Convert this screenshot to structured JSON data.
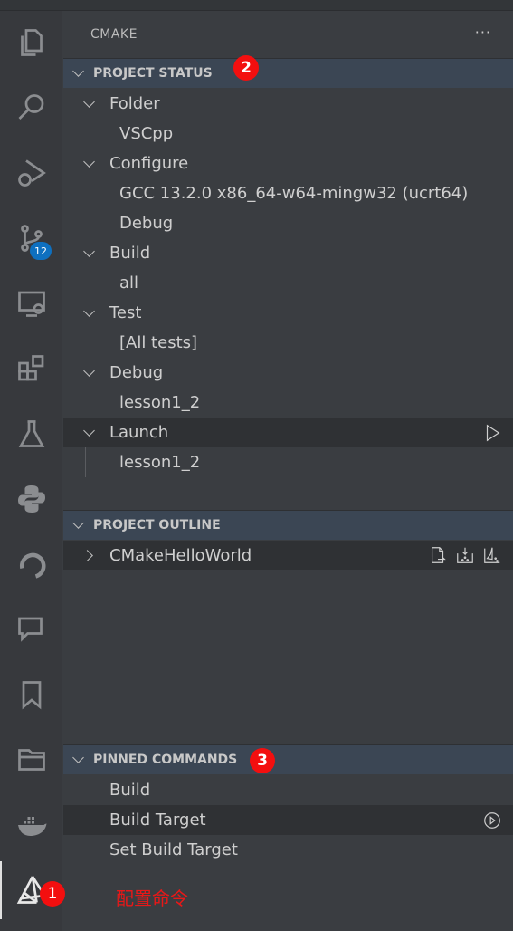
{
  "activity_bar": {
    "scm_badge": "12",
    "marker": "1"
  },
  "sidebar": {
    "title": "CMAKE",
    "more": "···"
  },
  "project_status": {
    "header": "PROJECT STATUS",
    "marker": "2",
    "items": [
      {
        "label": "Folder",
        "value": "VSCpp"
      },
      {
        "label": "Configure",
        "value": "GCC 13.2.0 x86_64-w64-mingw32 (ucrt64)",
        "value2": "Debug"
      },
      {
        "label": "Build",
        "value": "all"
      },
      {
        "label": "Test",
        "value": "[All tests]"
      },
      {
        "label": "Debug",
        "value": "lesson1_2"
      },
      {
        "label": "Launch",
        "value": "lesson1_2"
      }
    ]
  },
  "project_outline": {
    "header": "PROJECT OUTLINE",
    "items": [
      {
        "label": "CMakeHelloWorld"
      }
    ]
  },
  "pinned_commands": {
    "header": "PINNED COMMANDS",
    "marker": "3",
    "items": [
      {
        "label": "Build"
      },
      {
        "label": "Build Target"
      },
      {
        "label": "Set Build Target"
      }
    ]
  },
  "annotation": "配置命令",
  "colors": {
    "marker": "#f30f0f",
    "badge": "#0e70c0",
    "section": "#3b4654"
  }
}
